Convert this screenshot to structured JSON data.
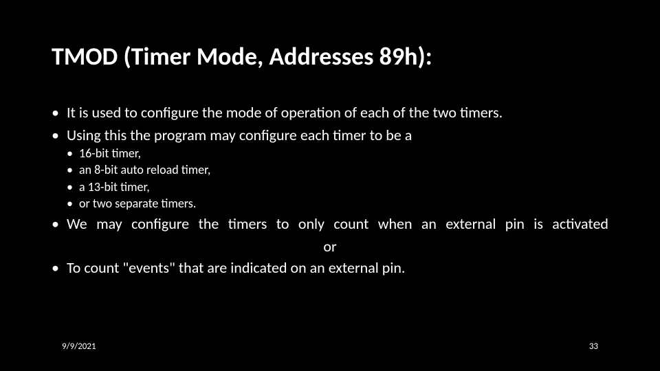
{
  "title": "TMOD (Timer Mode, Addresses 89h):",
  "bullets": {
    "b1": " It is used to configure the mode of operation of each of the two timers.",
    "b2": "Using this the  program may configure each timer to be a",
    "sub": {
      "s1": "16-bit timer,",
      "s2": "an 8-bit auto reload timer,",
      "s3": "a 13-bit timer,",
      "s4": "or two separate timers."
    },
    "b3": "We may configure the timers to only count when an external pin is activated",
    "or": "or",
    "b4": "To count \"events\" that are indicated on an external pin."
  },
  "footer": {
    "date": "9/9/2021",
    "page": "33"
  }
}
